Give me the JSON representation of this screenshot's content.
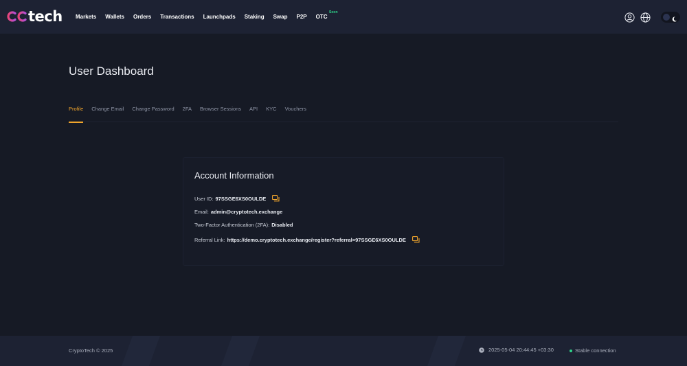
{
  "brand": {
    "logo_text": "tech",
    "colors": {
      "logo_pink": "#e8457a",
      "logo_purple": "#8b5cf6",
      "accent": "#f0a52c",
      "status_green": "#2fd38a"
    }
  },
  "nav": {
    "items": [
      {
        "label": "Markets"
      },
      {
        "label": "Wallets"
      },
      {
        "label": "Orders"
      },
      {
        "label": "Transactions"
      },
      {
        "label": "Launchpads"
      },
      {
        "label": "Staking"
      },
      {
        "label": "Swap"
      },
      {
        "label": "P2P"
      },
      {
        "label": "OTC",
        "badge": "Soon"
      }
    ],
    "icons": [
      "user-icon",
      "globe-icon",
      "theme-toggle-moon-icon"
    ]
  },
  "page": {
    "title": "User Dashboard"
  },
  "tabs": [
    {
      "label": "Profile",
      "active": true
    },
    {
      "label": "Change Email"
    },
    {
      "label": "Change Password"
    },
    {
      "label": "2FA"
    },
    {
      "label": "Browser Sessions"
    },
    {
      "label": "API"
    },
    {
      "label": "KYC"
    },
    {
      "label": "Vouchers"
    }
  ],
  "account": {
    "title": "Account Information",
    "user_id_label": "User ID:",
    "user_id": "97SSGE6XS0OULDE",
    "email_label": "Email:",
    "email": "admin@cryptotech.exchange",
    "twofa_label": "Two-Factor Authentication (2FA):",
    "twofa_status": "Disabled",
    "referral_label": "Referral Link:",
    "referral_link": "https://demo.cryptotech.exchange/register?referral=97SSGE6XS0OULDE"
  },
  "footer": {
    "copyright": "CryptoTech © 2025",
    "datetime": "2025-05-04 20:44:45 +03:30",
    "connection": "Stable connection"
  }
}
